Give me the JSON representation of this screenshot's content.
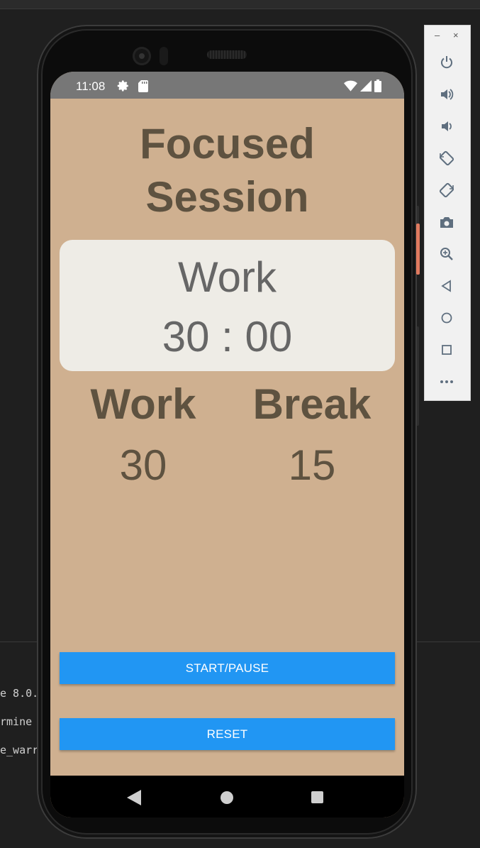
{
  "status_bar": {
    "time": "11:08"
  },
  "app": {
    "title_line1": "Focused",
    "title_line2": "Session",
    "timer": {
      "mode": "Work",
      "time": "30 : 00"
    },
    "work": {
      "label": "Work",
      "value": "30"
    },
    "break": {
      "label": "Break",
      "value": "15"
    },
    "buttons": {
      "start_pause": "START/PAUSE",
      "reset": "RESET"
    }
  },
  "console": {
    "line1": "e 8.0.",
    "line2": "rmine",
    "line3": "e_warr"
  },
  "emulator_toolbar": {
    "minimize": "–",
    "close": "×",
    "icons": [
      "power-icon",
      "volume-up-icon",
      "volume-down-icon",
      "rotate-left-icon",
      "rotate-right-icon",
      "camera-icon",
      "zoom-icon",
      "back-icon",
      "home-icon",
      "overview-icon",
      "more-icon"
    ]
  },
  "colors": {
    "app_background": "#cfb090",
    "card_background": "#eeece6",
    "heading_text": "#5e5240",
    "timer_text": "#666666",
    "button": "#2196f3",
    "status_bar": "#777777"
  }
}
